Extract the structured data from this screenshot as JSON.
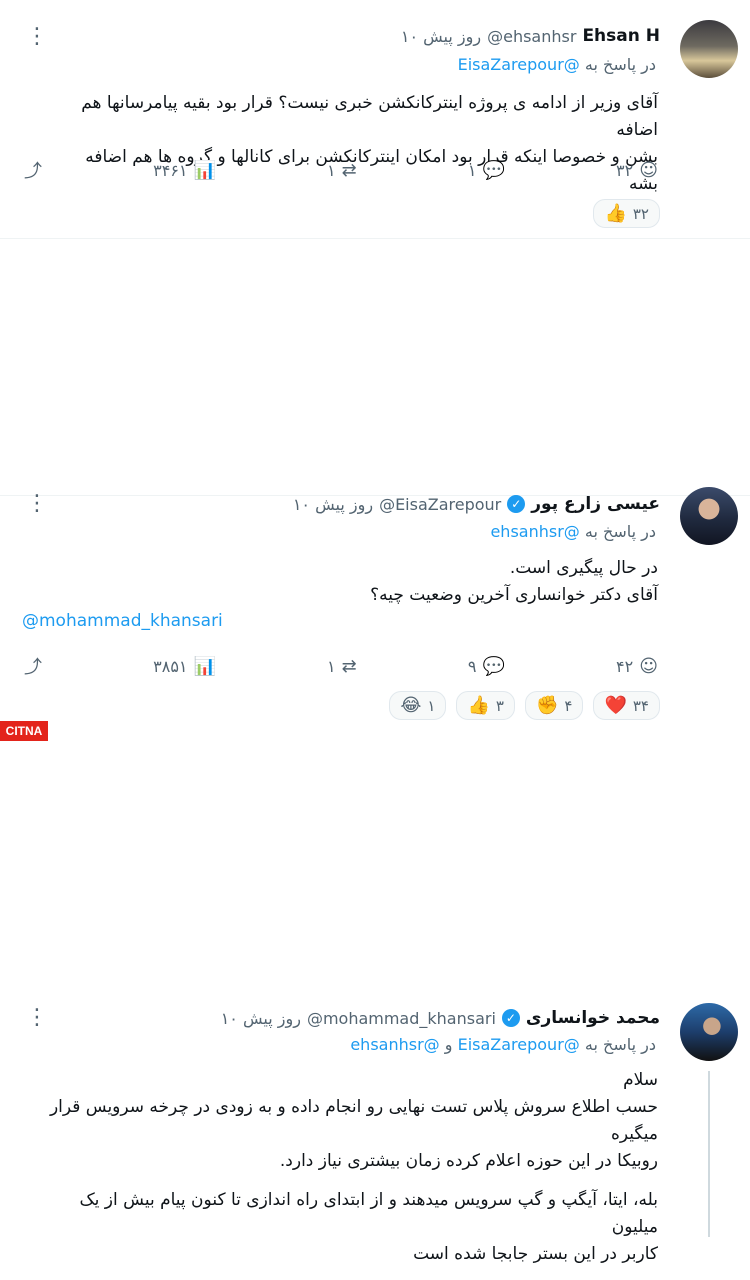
{
  "posts": [
    {
      "name": "Ehsan H",
      "handle": "@ehsanhsr",
      "time": "۱۰ روز پیش",
      "reply_prefix": "در پاسخ به",
      "reply_to": "@EisaZarepour",
      "text_lines": [
        "آقای وزیر از ادامه ی پروژه اینترکانکشن خبری نیست؟ قرار بود بقیه پیامرسانها هم اضافه",
        "بشن و خصوصا اینکه قرار بود امکان اینترکانکشن برای کانالها و گروه ها هم اضافه بشه"
      ],
      "actions": {
        "views": "۳۴۶۱",
        "reposts": "۱",
        "replies": "۱",
        "reactions": "۳۲"
      },
      "reactions": [
        {
          "emoji": "👍",
          "count": "۳۲"
        }
      ]
    },
    {
      "name": "عیسی زارع پور",
      "handle": "@EisaZarepour",
      "time": "۱۰ روز پیش",
      "verified": true,
      "reply_prefix": "در پاسخ به",
      "reply_to": "@ehsanhsr",
      "text_lines": [
        "در حال پیگیری است.",
        "آقای دکتر خوانساری آخرین وضعیت چیه؟"
      ],
      "mention": "@mohammad_khansari",
      "actions": {
        "views": "۳۸۵۱",
        "reposts": "۱",
        "replies": "۹",
        "reactions": "۴۲"
      },
      "reactions": [
        {
          "emoji": "❤️",
          "count": "۳۴"
        },
        {
          "emoji": "✊",
          "count": "۴"
        },
        {
          "emoji": "👍",
          "count": "۳"
        },
        {
          "emoji": "😂",
          "count": "۱"
        }
      ]
    },
    {
      "name": "محمد خوانساری",
      "handle": "@mohammad_khansari",
      "time": "۱۰ روز پیش",
      "verified": true,
      "reply_prefix": "در پاسخ به",
      "reply_to": "@EisaZarepour",
      "reply_join": "و",
      "reply_to_2": "@ehsanhsr",
      "text_lines": [
        "سلام",
        "حسب اطلاع سروش پلاس تست نهایی رو انجام داده و به زودی در چرخه سرویس قرار میگیره",
        "روبیکا در این حوزه اعلام کرده زمان بیشتری نیاز دارد."
      ],
      "text_lines_2": [
        "بله، ایتا، آیگپ و گپ سرویس میدهند و از ابتدای راه اندازی تا کنون پیام بیش از یک میلیون",
        "کاربر در این بستر جابجا شده است"
      ]
    }
  ],
  "watermark": "CITNA"
}
